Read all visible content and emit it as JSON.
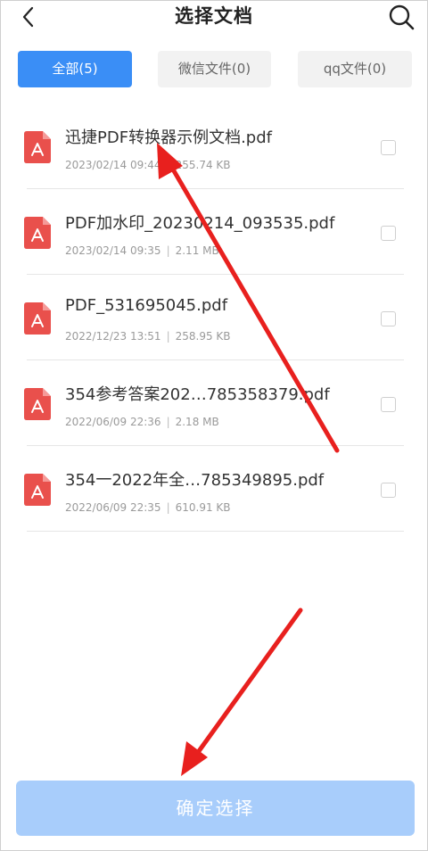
{
  "header": {
    "title": "选择文档"
  },
  "tabs": [
    {
      "label": "全部(5)",
      "active": true
    },
    {
      "label": "微信文件(0)",
      "active": false
    },
    {
      "label": "qq文件(0)",
      "active": false
    }
  ],
  "files": [
    {
      "name": "迅捷PDF转换器示例文档.pdf",
      "date": "2023/02/14 09:44",
      "size": "255.74 KB"
    },
    {
      "name": "PDF加水印_20230214_093535.pdf",
      "date": "2023/02/14 09:35",
      "size": "2.11 MB"
    },
    {
      "name": "PDF_531695045.pdf",
      "date": "2022/12/23 13:51",
      "size": "258.95 KB"
    },
    {
      "name": "354参考答案202…785358379.pdf",
      "date": "2022/06/09 22:36",
      "size": "2.18 MB"
    },
    {
      "name": "354一2022年全…785349895.pdf",
      "date": "2022/06/09 22:35",
      "size": "610.91 KB"
    }
  ],
  "meta_separator": "|",
  "confirm_label": "确定选择",
  "icons": {
    "back": "chevron-left-icon",
    "search": "search-icon",
    "file": "pdf-file-icon"
  },
  "colors": {
    "accent": "#3a8ef6",
    "pdf_red": "#e9504c",
    "confirm_disabled": "#a8cdfb",
    "annotation_arrow": "#e8201e"
  }
}
